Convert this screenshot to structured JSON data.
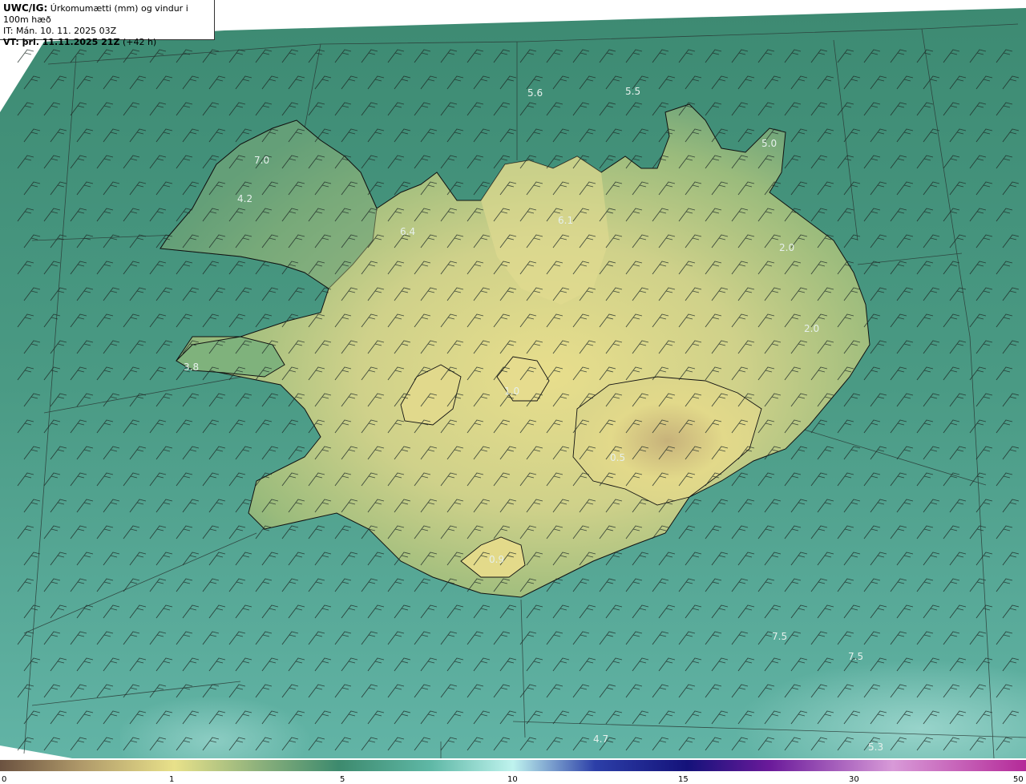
{
  "header": {
    "model": "UWC/IG:",
    "title": "Úrkomumætti (mm) og vindur i 100m hæð",
    "init_time": "IT: Mán. 10. 11. 2025 03Z",
    "valid_label": "VT: þri. 11.11.2025 21Z",
    "valid_offset": "(+42 h)"
  },
  "map_values": [
    {
      "text": "5.6"
    },
    {
      "text": "5.5"
    },
    {
      "text": "5.0"
    },
    {
      "text": "7.0"
    },
    {
      "text": "4.2"
    },
    {
      "text": "6.4"
    },
    {
      "text": "6.1"
    },
    {
      "text": "2.0"
    },
    {
      "text": "2.0"
    },
    {
      "text": "3.8"
    },
    {
      "text": "1.0"
    },
    {
      "text": "0.5"
    },
    {
      "text": "0.9"
    },
    {
      "text": "7.5"
    },
    {
      "text": "7.5"
    },
    {
      "text": "4.7"
    },
    {
      "text": "5.3"
    }
  ],
  "colorbar": {
    "ticks": [
      "0",
      "1",
      "5",
      "10",
      "15",
      "30",
      "50"
    ],
    "colors": [
      "#6b5240",
      "#b09a6a",
      "#e8e18a",
      "#8fb27c",
      "#3d8a6e",
      "#5fb8a6",
      "#bff3ee",
      "#2c3fa8",
      "#14127a",
      "#6a1a9a",
      "#d89ad8",
      "#b42a98"
    ]
  }
}
